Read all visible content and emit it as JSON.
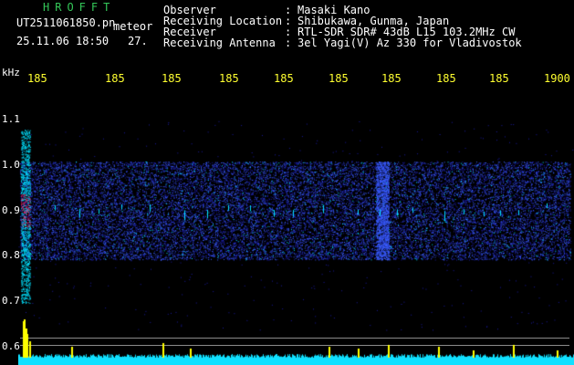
{
  "header": {
    "app_title": "HROFFT",
    "filename": "UT2511061850.pn",
    "type_label": "meteor",
    "datetime": "25.11.06 18:50",
    "count": "27.",
    "info": [
      {
        "label": "Observer",
        "value": "Masaki Kano"
      },
      {
        "label": "Receiving Location",
        "value": "Shibukawa, Gunma, Japan"
      },
      {
        "label": "Receiver",
        "value": "RTL-SDR SDR# 43dB L15 103.2MHz CW"
      },
      {
        "label": "Receiving Antenna",
        "value": "3el Yagi(V) Az 330 for Vladivostok"
      }
    ],
    "separator": ":"
  },
  "axes": {
    "y_unit": "kHz",
    "y_ticks": [
      "1.1",
      "1.0",
      "0.9",
      "0.8",
      "0.7",
      "0.6"
    ],
    "x_ticks": [
      "185",
      "185",
      "185",
      "185",
      "185",
      "185",
      "185",
      "185",
      "185",
      "1900"
    ]
  },
  "chart_data": {
    "type": "heatmap",
    "y_unit": "kHz",
    "y_ticks": [
      1.1,
      1.0,
      0.9,
      0.8,
      0.7,
      0.6
    ],
    "x_ticks": [
      "185",
      "185",
      "185",
      "185",
      "185",
      "185",
      "185",
      "185",
      "185",
      "1900"
    ],
    "signal_band_khz": [
      0.8,
      1.0
    ],
    "center_khz": 0.9,
    "colors": {
      "background": "#000000",
      "noise_low": "#1a1aa0",
      "noise_high": "#3a5cff",
      "strong": "#00e0ff",
      "peak": "#ff2060",
      "tick_labels": "#ffff30",
      "title": "#34c759",
      "spectrum_fill": "#10e0ff",
      "spectrum_peak": "#ffff00"
    }
  }
}
